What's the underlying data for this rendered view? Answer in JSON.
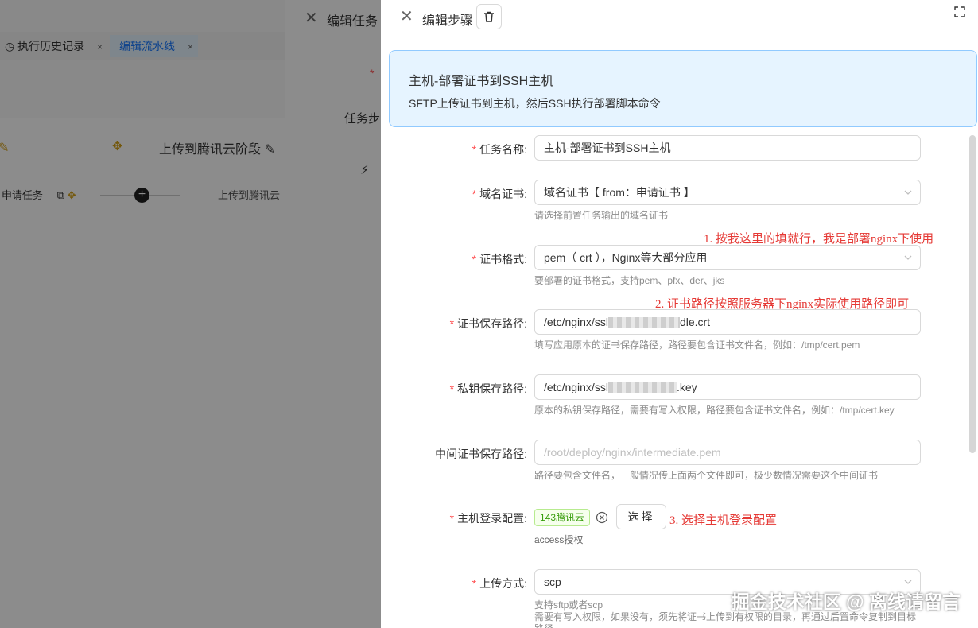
{
  "background": {
    "tabs": [
      {
        "label": "执行历史记录",
        "close": "×"
      },
      {
        "label": "编辑流水线",
        "close": "×"
      }
    ],
    "stage_title": "上传到腾讯云阶段",
    "task_left": "申请任务",
    "task_right": "上传到腾讯云",
    "plus": "+"
  },
  "task_drawer": {
    "title": "编辑任务",
    "required_mark": "*",
    "steps_label": "任务步"
  },
  "step_drawer": {
    "title": "编辑步骤",
    "info": {
      "heading": "主机-部署证书到SSH主机",
      "description": "SFTP上传证书到主机，然后SSH执行部署脚本命令"
    },
    "fields": {
      "task_name": {
        "label": "任务名称:",
        "value": "主机-部署证书到SSH主机"
      },
      "domain_cert": {
        "label": "域名证书:",
        "value": "域名证书【 from：申请证书 】",
        "help": "请选择前置任务输出的域名证书"
      },
      "cert_format": {
        "label": "证书格式:",
        "value": "pem（ crt ），Nginx等大部分应用",
        "help": "要部署的证书格式，支持pem、pfx、der、jks"
      },
      "cert_path": {
        "label": "证书保存路径:",
        "value_prefix": "/etc/nginx/ssl",
        "value_suffix": "dle.crt",
        "help": "填写应用原本的证书保存路径，路径要包含证书文件名，例如：/tmp/cert.pem"
      },
      "key_path": {
        "label": "私钥保存路径:",
        "value_prefix": "/etc/nginx/ssl",
        "value_suffix": ".key",
        "help": "原本的私钥保存路径，需要有写入权限，路径要包含证书文件名，例如：/tmp/cert.key"
      },
      "intermediate_path": {
        "label": "中间证书保存路径:",
        "placeholder": "/root/deploy/nginx/intermediate.pem",
        "help": "路径要包含文件名，一般情况传上面两个文件即可，极少数情况需要这个中间证书"
      },
      "host_login": {
        "label": "主机登录配置:",
        "tag": "143腾讯云",
        "choose": "选择",
        "help": "access授权"
      },
      "upload_method": {
        "label": "上传方式:",
        "value": "scp",
        "help1": "支持sftp或者scp",
        "help2": "需要有写入权限，如果没有，须先将证书上传到有权限的目录，再通过后置命令复制到目标",
        "help3": "路径"
      }
    },
    "annotations": {
      "a1": "1. 按我这里的填就行，我是部署nginx下使用",
      "a2": "2. 证书路径按照服务器下nginx实际使用路径即可",
      "a3": "3. 选择主机登录配置"
    }
  },
  "watermark": "掘金技术社区 @ 离线请留言"
}
